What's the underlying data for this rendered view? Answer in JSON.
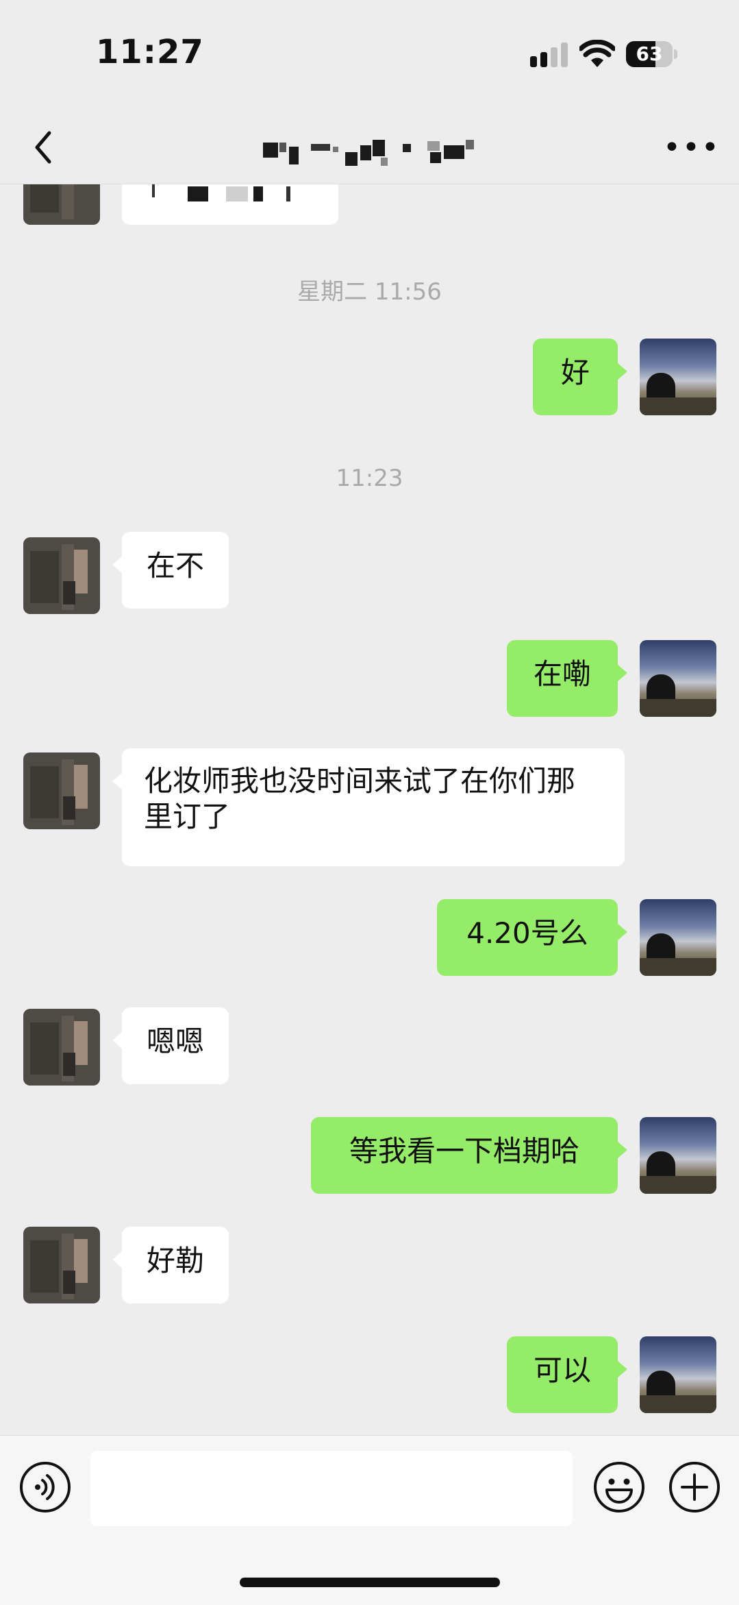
{
  "status_bar": {
    "time": "11:27",
    "battery_level": "63",
    "battery_fraction": 0.63
  },
  "header": {
    "back_icon": "chevron-left-icon",
    "title_redacted": true,
    "more_icon": "ellipsis-icon"
  },
  "messages": [
    {
      "type": "timestamp",
      "text": "星期二 11:56"
    },
    {
      "type": "out",
      "text": "好"
    },
    {
      "type": "timestamp",
      "text": "11:23"
    },
    {
      "type": "in",
      "text": "在不"
    },
    {
      "type": "out",
      "text": "在嘞"
    },
    {
      "type": "in",
      "text": "化妆师我也没时间来试了在你们那里订了"
    },
    {
      "type": "out",
      "text": "4.20号么"
    },
    {
      "type": "in",
      "text": "嗯嗯"
    },
    {
      "type": "out",
      "text": "等我看一下档期哈"
    },
    {
      "type": "in",
      "text": "好勒"
    },
    {
      "type": "out",
      "text": "可以"
    }
  ],
  "input_bar": {
    "text_value": "",
    "voice_icon": "voice-icon",
    "emoji_icon": "emoji-icon",
    "plus_icon": "plus-icon"
  },
  "colors": {
    "background": "#ededed",
    "outgoing_bubble": "#95ec69",
    "incoming_bubble": "#ffffff",
    "timestamp": "#a9a9a9"
  }
}
